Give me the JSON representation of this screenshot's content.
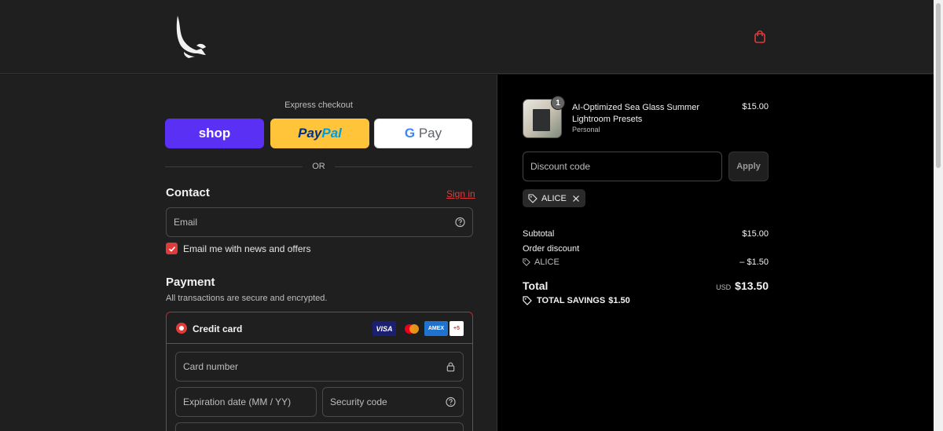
{
  "header": {
    "logo_name": "eagle-logo",
    "cart_icon": "shopping-bag-icon"
  },
  "express": {
    "label": "Express checkout",
    "shop_label": "shop",
    "paypal_part1": "Pay",
    "paypal_part2": "Pal",
    "gpay_g": "G",
    "gpay_label": "Pay",
    "or_label": "OR"
  },
  "contact": {
    "title": "Contact",
    "signin_label": "Sign in",
    "email_placeholder": "Email",
    "newsletter_label": "Email me with news and offers",
    "newsletter_checked": true
  },
  "payment": {
    "title": "Payment",
    "subtitle": "All transactions are secure and encrypted.",
    "method_label": "Credit card",
    "brands": {
      "visa": "VISA",
      "amex": "AMEX",
      "more": "+5"
    },
    "card_number_placeholder": "Card number",
    "expiry_placeholder": "Expiration date (MM / YY)",
    "security_placeholder": "Security code"
  },
  "summary": {
    "item": {
      "quantity": "1",
      "name": "AI-Optimized Sea Glass Summer Lightroom Presets",
      "variant": "Personal",
      "price": "$15.00"
    },
    "discount_placeholder": "Discount code",
    "apply_label": "Apply",
    "applied_code": "ALICE",
    "subtotal_label": "Subtotal",
    "subtotal_value": "$15.00",
    "order_discount_label": "Order discount",
    "discount_code_label": "ALICE",
    "discount_value": "– $1.50",
    "total_label": "Total",
    "currency": "USD",
    "total_value": "$13.50",
    "savings_label": "TOTAL SAVINGS",
    "savings_value": "$1.50"
  },
  "colors": {
    "accent": "#e03a3a",
    "shop": "#5a31f4",
    "paypal": "#ffc439"
  }
}
